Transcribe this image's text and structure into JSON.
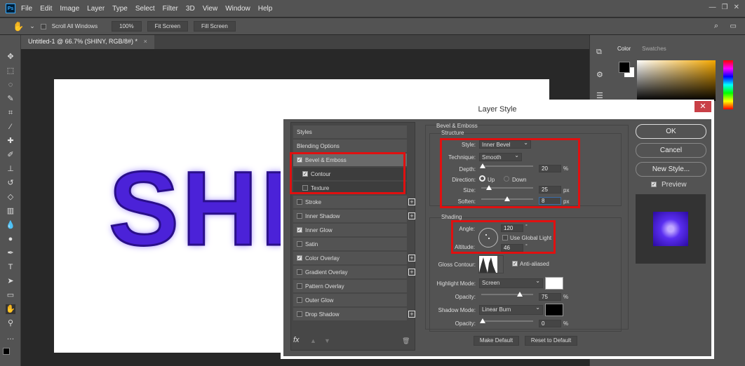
{
  "app": {
    "logo": "Ps",
    "menu": [
      "File",
      "Edit",
      "Image",
      "Layer",
      "Type",
      "Select",
      "Filter",
      "3D",
      "View",
      "Window",
      "Help"
    ]
  },
  "options": {
    "scroll_all": "Scroll All Windows",
    "zoom": "100%",
    "fit": "Fit Screen",
    "fill": "Fill Screen"
  },
  "document": {
    "tab": "Untitled-1 @ 66.7% (SHINY, RGB/8#) *",
    "text": "SHINY",
    "text_color": "#4b22d8"
  },
  "color_panel": {
    "tabs": [
      "Color",
      "Swatches"
    ],
    "foreground": "#000000",
    "background": "#ffffff"
  },
  "dialog": {
    "title": "Layer Style",
    "styles": [
      {
        "label": "Styles",
        "check": null
      },
      {
        "label": "Blending Options",
        "check": null
      },
      {
        "label": "Bevel & Emboss",
        "check": true,
        "selected": true
      },
      {
        "label": "Contour",
        "check": true,
        "sub": true
      },
      {
        "label": "Texture",
        "check": false,
        "sub": true
      },
      {
        "label": "Stroke",
        "check": false,
        "plus": true
      },
      {
        "label": "Inner Shadow",
        "check": false,
        "plus": true
      },
      {
        "label": "Inner Glow",
        "check": true
      },
      {
        "label": "Satin",
        "check": false
      },
      {
        "label": "Color Overlay",
        "check": true,
        "plus": true
      },
      {
        "label": "Gradient Overlay",
        "check": false,
        "plus": true
      },
      {
        "label": "Pattern Overlay",
        "check": false
      },
      {
        "label": "Outer Glow",
        "check": false
      },
      {
        "label": "Drop Shadow",
        "check": false,
        "plus": true
      }
    ],
    "section": "Bevel & Emboss",
    "structure": {
      "title": "Structure",
      "style_label": "Style:",
      "style": "Inner Bevel",
      "technique_label": "Technique:",
      "technique": "Smooth",
      "depth_label": "Depth:",
      "depth": "20",
      "depth_unit": "%",
      "direction_label": "Direction:",
      "up": "Up",
      "down": "Down",
      "direction": "Up",
      "size_label": "Size:",
      "size": "25",
      "size_unit": "px",
      "soften_label": "Soften:",
      "soften": "8",
      "soften_unit": "px"
    },
    "shading": {
      "title": "Shading",
      "angle_label": "Angle:",
      "angle": "120",
      "deg": "°",
      "global_light": "Use Global Light",
      "altitude_label": "Altitude:",
      "altitude": "46",
      "gloss_label": "Gloss Contour:",
      "anti_aliased": "Anti-aliased",
      "highlight_label": "Highlight Mode:",
      "highlight_mode": "Screen",
      "highlight_color": "#ffffff",
      "opacity_label": "Opacity:",
      "highlight_opacity": "75",
      "pct": "%",
      "shadow_label": "Shadow Mode:",
      "shadow_mode": "Linear Burn",
      "shadow_color": "#000000",
      "shadow_opacity": "0"
    },
    "make_default": "Make Default",
    "reset_default": "Reset to Default",
    "ok": "OK",
    "cancel": "Cancel",
    "new_style": "New Style...",
    "preview": "Preview",
    "fx": "fx"
  }
}
